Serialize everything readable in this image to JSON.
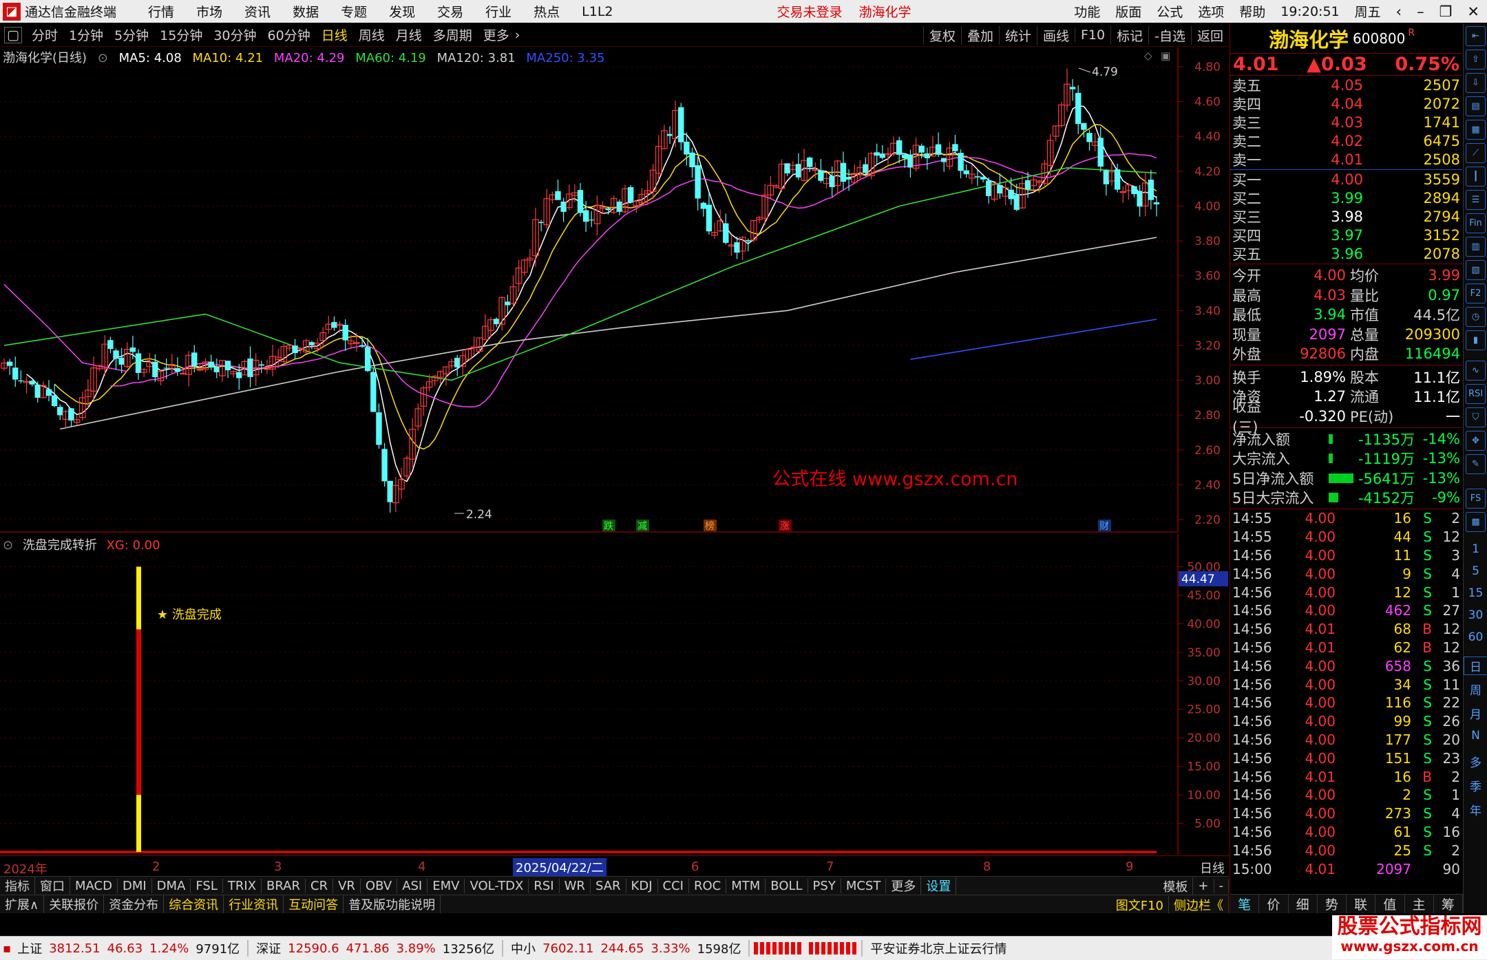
{
  "titlebar": {
    "app_title": "通达信金融终端",
    "menus": [
      "行情",
      "市场",
      "资讯",
      "数据",
      "专题",
      "发现",
      "交易",
      "行业",
      "热点",
      "L1L2"
    ],
    "login_status": "交易未登录",
    "stock_name": "渤海化学",
    "right_menus": [
      "功能",
      "版面",
      "公式",
      "选项",
      "帮助"
    ],
    "time": "19:20:51",
    "weekday": "周五"
  },
  "periodbar": {
    "periods": [
      "分时",
      "1分钟",
      "5分钟",
      "15分钟",
      "30分钟",
      "60分钟",
      "日线",
      "周线",
      "月线",
      "多周期",
      "更多"
    ],
    "active": "日线",
    "tools": [
      "复权",
      "叠加",
      "统计",
      "画线",
      "F10",
      "标记",
      "-自选",
      "返回"
    ]
  },
  "main_chart_header": {
    "title": "渤海化学(日线)",
    "ma": [
      {
        "label": "MA5: 4.08",
        "color": "#ffffff"
      },
      {
        "label": "MA10: 4.21",
        "color": "#ffdd00"
      },
      {
        "label": "MA20: 4.29",
        "color": "#ff40ff"
      },
      {
        "label": "MA60: 4.19",
        "color": "#30e030"
      },
      {
        "label": "MA120: 3.81",
        "color": "#d0d0d0"
      },
      {
        "label": "MA250: 3.35",
        "color": "#3050ff"
      }
    ]
  },
  "indicator_header": {
    "title": "洗盘完成转折",
    "xg": "XG: 0.00"
  },
  "watermark_center": "公式在线 www.gszx.com.cn",
  "event_tags": [
    "跌",
    "减",
    "榜",
    "涨",
    "财"
  ],
  "high_label": "4.79",
  "low_label": "2.24",
  "signal_label": "★ 洗盘完成",
  "current_indicator_value": "44.47",
  "date_axis": {
    "start": "2024年",
    "months": [
      "2",
      "3",
      "4",
      "6",
      "7",
      "8",
      "9"
    ],
    "selected": "2025/04/22/二",
    "period": "日线"
  },
  "indicator_tabs": [
    "指标",
    "窗口",
    "MACD",
    "DMI",
    "DMA",
    "FSL",
    "TRIX",
    "BRAR",
    "CR",
    "VR",
    "OBV",
    "ASI",
    "EMV",
    "VOL-TDX",
    "RSI",
    "WR",
    "SAR",
    "KDJ",
    "CCI",
    "ROC",
    "MTM",
    "BOLL",
    "PSY",
    "MCST",
    "更多",
    "设置"
  ],
  "indicator_tabs_right": [
    "模板",
    "+",
    "-"
  ],
  "bottom_tabs": [
    "扩展∧",
    "关联报价",
    "资金分布",
    "综合资讯",
    "行业资讯",
    "互动问答",
    "普及版功能说明"
  ],
  "bottom_tabs_right": [
    "图文F10",
    "侧边栏《"
  ],
  "quote": {
    "name": "渤海化学",
    "code": "600800",
    "code_mark": "R",
    "price": "4.01",
    "change": "▲0.03",
    "pct": "0.75%",
    "asks": [
      [
        "卖五",
        "4.05",
        "2507"
      ],
      [
        "卖四",
        "4.04",
        "2072"
      ],
      [
        "卖三",
        "4.03",
        "1741"
      ],
      [
        "卖二",
        "4.02",
        "6475"
      ],
      [
        "卖一",
        "4.01",
        "2508"
      ]
    ],
    "bids": [
      [
        "买一",
        "4.00",
        "3559"
      ],
      [
        "买二",
        "3.99",
        "2894"
      ],
      [
        "买三",
        "3.98",
        "2794"
      ],
      [
        "买四",
        "3.97",
        "3152"
      ],
      [
        "买五",
        "3.96",
        "2078"
      ]
    ],
    "stats": [
      [
        "今开",
        "4.00",
        "均价",
        "3.99"
      ],
      [
        "最高",
        "4.03",
        "量比",
        "0.97"
      ],
      [
        "最低",
        "3.94",
        "市值",
        "44.5亿"
      ],
      [
        "现量",
        "2097",
        "总量",
        "209300"
      ],
      [
        "外盘",
        "92806",
        "内盘",
        "116494"
      ]
    ],
    "stats2": [
      [
        "换手",
        "1.89%",
        "股本",
        "11.1亿"
      ],
      [
        "净资",
        "1.27",
        "流通",
        "11.1亿"
      ],
      [
        "收益(三)",
        "-0.320",
        "PE(动)",
        "一"
      ]
    ],
    "flows": [
      [
        "净流入额",
        "-1135万",
        "-14%"
      ],
      [
        "大宗流入",
        "-1119万",
        "-13%"
      ],
      [
        "5日净流入额",
        "-5641万",
        "-13%"
      ],
      [
        "5日大宗流入",
        "-4152万",
        "-9%"
      ]
    ],
    "ticks": [
      [
        "14:55",
        "4.00",
        "16",
        "S",
        "2"
      ],
      [
        "14:55",
        "4.00",
        "44",
        "S",
        "12"
      ],
      [
        "14:56",
        "4.00",
        "11",
        "S",
        "3"
      ],
      [
        "14:56",
        "4.00",
        "9",
        "S",
        "4"
      ],
      [
        "14:56",
        "4.00",
        "12",
        "S",
        "1"
      ],
      [
        "14:56",
        "4.00",
        "462",
        "S",
        "27"
      ],
      [
        "14:56",
        "4.01",
        "68",
        "B",
        "12"
      ],
      [
        "14:56",
        "4.01",
        "62",
        "B",
        "12"
      ],
      [
        "14:56",
        "4.00",
        "658",
        "S",
        "36"
      ],
      [
        "14:56",
        "4.00",
        "34",
        "S",
        "11"
      ],
      [
        "14:56",
        "4.00",
        "116",
        "S",
        "22"
      ],
      [
        "14:56",
        "4.00",
        "99",
        "S",
        "26"
      ],
      [
        "14:56",
        "4.00",
        "177",
        "S",
        "20"
      ],
      [
        "14:56",
        "4.00",
        "151",
        "S",
        "23"
      ],
      [
        "14:56",
        "4.01",
        "16",
        "B",
        "2"
      ],
      [
        "14:56",
        "4.00",
        "2",
        "S",
        "1"
      ],
      [
        "14:56",
        "4.00",
        "273",
        "S",
        "4"
      ],
      [
        "14:56",
        "4.00",
        "61",
        "S",
        "16"
      ],
      [
        "14:56",
        "4.00",
        "25",
        "S",
        "2"
      ],
      [
        "15:00",
        "4.01",
        "2097",
        "",
        "90"
      ]
    ],
    "tabs": [
      "笔",
      "价",
      "细",
      "势",
      "联",
      "值",
      "主",
      "筹"
    ]
  },
  "sidebar_labels": [
    "日",
    "周",
    "月",
    "N",
    "多",
    "季",
    "年"
  ],
  "sidebar_nums": [
    "1",
    "5",
    "15",
    "30",
    "60"
  ],
  "statusbar": {
    "items": [
      {
        "name": "上证",
        "price": "3812.51",
        "chg": "46.63",
        "pct": "1.24%",
        "amt": "9791亿"
      },
      {
        "name": "深证",
        "price": "12590.6",
        "chg": "471.86",
        "pct": "3.89%",
        "amt": "13256亿"
      },
      {
        "name": "中小",
        "price": "7602.11",
        "chg": "244.65",
        "pct": "3.33%",
        "amt": "1598亿"
      }
    ],
    "broker": "平安证券北京上证云行情"
  },
  "site_watermark": {
    "line1": "股票公式指标网",
    "line2": "www.gszx.com.cn"
  },
  "chart_data": [
    {
      "type": "candlestick",
      "title": "渤海化学(日线)",
      "ylim": [
        2.2,
        4.8
      ],
      "yticks": [
        "4.80",
        "4.60",
        "4.40",
        "4.20",
        "4.00",
        "3.80",
        "3.60",
        "3.40",
        "3.20",
        "3.00",
        "2.80",
        "2.60",
        "2.40",
        "2.20"
      ],
      "waypoints": [
        [
          0,
          3.1
        ],
        [
          8,
          2.9
        ],
        [
          12,
          2.75
        ],
        [
          18,
          3.2
        ],
        [
          26,
          3.05
        ],
        [
          36,
          3.1
        ],
        [
          44,
          3.05
        ],
        [
          52,
          3.2
        ],
        [
          58,
          3.3
        ],
        [
          64,
          3.2
        ],
        [
          69,
          2.26
        ],
        [
          75,
          2.9
        ],
        [
          80,
          3.1
        ],
        [
          88,
          3.35
        ],
        [
          98,
          4.05
        ],
        [
          108,
          3.95
        ],
        [
          116,
          4.2
        ],
        [
          120,
          4.55
        ],
        [
          126,
          3.9
        ],
        [
          132,
          3.8
        ],
        [
          138,
          4.2
        ],
        [
          148,
          4.18
        ],
        [
          156,
          4.3
        ],
        [
          164,
          4.28
        ],
        [
          170,
          4.25
        ],
        [
          176,
          4.05
        ],
        [
          182,
          4.05
        ],
        [
          186,
          4.2
        ],
        [
          190,
          4.72
        ],
        [
          196,
          4.2
        ],
        [
          202,
          4.1
        ],
        [
          206,
          4.01
        ]
      ],
      "ma_overlays": [
        {
          "name": "MA120",
          "points": [
            [
              10,
              2.72
            ],
            [
              60,
              3.05
            ],
            [
              90,
              3.22
            ],
            [
              110,
              3.3
            ],
            [
              140,
              3.4
            ],
            [
              170,
              3.62
            ],
            [
              206,
              3.82
            ]
          ]
        },
        {
          "name": "MA60",
          "points": [
            [
              0,
              3.2
            ],
            [
              36,
              3.38
            ],
            [
              60,
              3.1
            ],
            [
              80,
              3.0
            ],
            [
              100,
              3.25
            ],
            [
              130,
              3.65
            ],
            [
              160,
              4.0
            ],
            [
              190,
              4.22
            ],
            [
              206,
              4.19
            ]
          ]
        },
        {
          "name": "MA250",
          "points": [
            [
              162,
              3.12
            ],
            [
              206,
              3.35
            ]
          ]
        }
      ]
    },
    {
      "type": "bar",
      "title": "洗盘完成转折",
      "ylim": [
        0,
        55
      ],
      "yticks": [
        "50.00",
        "45.00",
        "40.00",
        "35.00",
        "30.00",
        "25.00",
        "20.00",
        "15.00",
        "10.00",
        "5.00"
      ],
      "x": [
        24
      ],
      "values": [
        50
      ]
    }
  ]
}
